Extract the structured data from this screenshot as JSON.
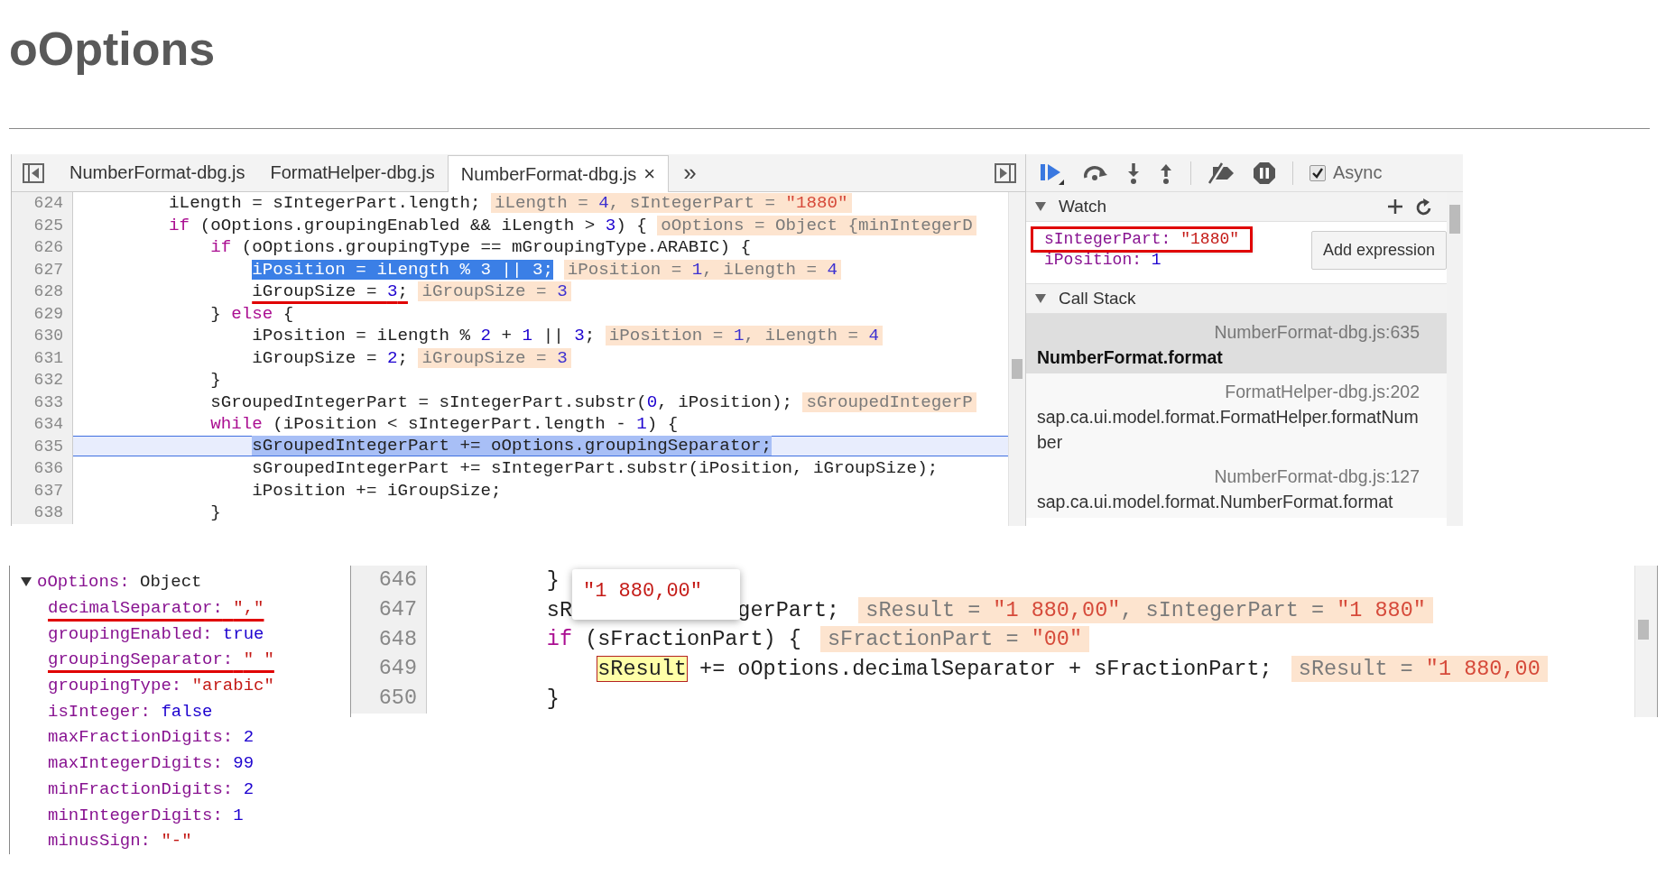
{
  "title": "oOptions",
  "sources": {
    "tabs": [
      {
        "label": "NumberFormat-dbg.js",
        "selected": false
      },
      {
        "label": "FormatHelper-dbg.js",
        "selected": false
      },
      {
        "label": "NumberFormat-dbg.js",
        "selected": true,
        "close": "×"
      }
    ],
    "more": "»",
    "lines": [
      {
        "number": "624",
        "current": false,
        "underlined": false,
        "code": [
          {
            "kind": "plain",
            "text": "iLength = sIntegerPart.length;"
          }
        ],
        "value": [
          {
            "kind": "plain",
            "text": "iLength = "
          },
          {
            "kind": "num",
            "text": "4"
          },
          {
            "kind": "plain",
            "text": ", sIntegerPart = "
          },
          {
            "kind": "str",
            "text": "\"1880\""
          }
        ]
      },
      {
        "number": "625",
        "current": false,
        "underlined": false,
        "code": [
          {
            "kind": "kw",
            "text": "if"
          },
          {
            "kind": "plain",
            "text": " (oOptions.groupingEnabled && iLength > "
          },
          {
            "kind": "num",
            "text": "3"
          },
          {
            "kind": "plain",
            "text": ") {"
          }
        ],
        "value": [
          {
            "kind": "plain",
            "text": "oOptions = Object {minIntegerD"
          }
        ],
        "children": [
          {
            "number": "626",
            "current": false,
            "underlined": false,
            "code": [
              {
                "kind": "kw",
                "text": "if"
              },
              {
                "kind": "plain",
                "text": " (oOptions.groupingType == mGroupingType.ARABIC) {"
              }
            ],
            "children": [
              {
                "number": "627",
                "current": false,
                "underlined": false,
                "code": [
                  {
                    "kind": "sel",
                    "text": "iPosition = iLength % 3 || 3;"
                  }
                ],
                "value": [
                  {
                    "kind": "plain",
                    "text": "iPosition = "
                  },
                  {
                    "kind": "num",
                    "text": "1"
                  },
                  {
                    "kind": "plain",
                    "text": ", iLength = "
                  },
                  {
                    "kind": "num",
                    "text": "4"
                  }
                ]
              },
              {
                "number": "628",
                "current": false,
                "underlined": true,
                "code": [
                  {
                    "kind": "plain",
                    "text": "iGroupSize = "
                  },
                  {
                    "kind": "num",
                    "text": "3"
                  },
                  {
                    "kind": "plain",
                    "text": ";"
                  }
                ],
                "value": [
                  {
                    "kind": "plain",
                    "text": "iGroupSize = "
                  },
                  {
                    "kind": "num",
                    "text": "3"
                  }
                ]
              }
            ]
          },
          {
            "number": "629",
            "current": false,
            "underlined": false,
            "code": [
              {
                "kind": "plain",
                "text": "} "
              },
              {
                "kind": "kw",
                "text": "else"
              },
              {
                "kind": "plain",
                "text": " {"
              }
            ],
            "children": [
              {
                "number": "630",
                "current": false,
                "underlined": false,
                "code": [
                  {
                    "kind": "plain",
                    "text": "iPosition = iLength % "
                  },
                  {
                    "kind": "num",
                    "text": "2"
                  },
                  {
                    "kind": "plain",
                    "text": " + "
                  },
                  {
                    "kind": "num",
                    "text": "1"
                  },
                  {
                    "kind": "plain",
                    "text": " || "
                  },
                  {
                    "kind": "num",
                    "text": "3"
                  },
                  {
                    "kind": "plain",
                    "text": ";"
                  }
                ],
                "value": [
                  {
                    "kind": "plain",
                    "text": "iPosition = "
                  },
                  {
                    "kind": "num",
                    "text": "1"
                  },
                  {
                    "kind": "plain",
                    "text": ", iLength = "
                  },
                  {
                    "kind": "num",
                    "text": "4"
                  }
                ]
              },
              {
                "number": "631",
                "current": false,
                "underlined": false,
                "code": [
                  {
                    "kind": "plain",
                    "text": "iGroupSize = "
                  },
                  {
                    "kind": "num",
                    "text": "2"
                  },
                  {
                    "kind": "plain",
                    "text": ";"
                  }
                ],
                "value": [
                  {
                    "kind": "plain",
                    "text": "iGroupSize = "
                  },
                  {
                    "kind": "num",
                    "text": "3"
                  }
                ]
              }
            ]
          },
          {
            "number": "632",
            "current": false,
            "underlined": false,
            "code": [
              {
                "kind": "plain",
                "text": "}"
              }
            ]
          },
          {
            "number": "633",
            "current": false,
            "underlined": false,
            "code": [
              {
                "kind": "plain",
                "text": "sGroupedIntegerPart = sIntegerPart.substr("
              },
              {
                "kind": "num",
                "text": "0"
              },
              {
                "kind": "plain",
                "text": ", iPosition);"
              }
            ],
            "value": [
              {
                "kind": "plain",
                "text": "sGroupedIntegerP"
              }
            ]
          },
          {
            "number": "634",
            "current": false,
            "underlined": false,
            "code": [
              {
                "kind": "kw",
                "text": "while"
              },
              {
                "kind": "plain",
                "text": " (iPosition < sIntegerPart.length - "
              },
              {
                "kind": "num",
                "text": "1"
              },
              {
                "kind": "plain",
                "text": ") {"
              }
            ],
            "children": [
              {
                "number": "635",
                "current": true,
                "underlined": false,
                "code": [
                  {
                    "kind": "exec",
                    "text": "sGroupedIntegerPart += oOptions.groupingSeparator;"
                  }
                ]
              },
              {
                "number": "636",
                "current": false,
                "underlined": false,
                "code": [
                  {
                    "kind": "plain",
                    "text": "sGroupedIntegerPart += sIntegerPart.substr(iPosition, iGroupSize);"
                  }
                ]
              },
              {
                "number": "637",
                "current": false,
                "underlined": false,
                "code": [
                  {
                    "kind": "plain",
                    "text": "iPosition += iGroupSize;"
                  }
                ]
              }
            ]
          },
          {
            "number": "638",
            "current": false,
            "underlined": false,
            "code": [
              {
                "kind": "plain",
                "text": "}"
              }
            ]
          }
        ]
      }
    ]
  },
  "debugger": {
    "async": {
      "label": "Async",
      "checked": true
    },
    "watch": {
      "title": "Watch",
      "expanded": true,
      "add_button": "Add expression",
      "entries": [
        {
          "name": "sIntegerPart:",
          "value": "\"1880\"",
          "kind": "str",
          "boxed": true
        },
        {
          "name": "iPosition:",
          "value": "1",
          "kind": "num",
          "boxed": false
        }
      ]
    },
    "call_stack": {
      "title": "Call Stack",
      "expanded": true,
      "frames": [
        {
          "location": "NumberFormat-dbg.js:635",
          "function": "NumberFormat.format",
          "selected": true
        },
        {
          "location": "FormatHelper-dbg.js:202",
          "function": "sap.ca.ui.model.format.FormatHelper.formatNumber",
          "selected": false
        },
        {
          "location": "NumberFormat-dbg.js:127",
          "function": "sap.ca.ui.model.format.NumberFormat.format",
          "selected": false
        }
      ]
    }
  },
  "object_tree": {
    "name": "oOptions:",
    "type": "Object",
    "expanded": true,
    "properties": [
      {
        "name": "decimalSeparator:",
        "value": "\",\"",
        "kind": "str",
        "underlined": true
      },
      {
        "name": "groupingEnabled:",
        "value": "true",
        "kind": "num",
        "underlined": false
      },
      {
        "name": "groupingSeparator:",
        "value": "\" \"",
        "kind": "str",
        "underlined": true
      },
      {
        "name": "groupingType:",
        "value": "\"arabic\"",
        "kind": "str",
        "underlined": false
      },
      {
        "name": "isInteger:",
        "value": "false",
        "kind": "num",
        "underlined": false
      },
      {
        "name": "maxFractionDigits:",
        "value": "2",
        "kind": "num",
        "underlined": false
      },
      {
        "name": "maxIntegerDigits:",
        "value": "99",
        "kind": "num",
        "underlined": false
      },
      {
        "name": "minFractionDigits:",
        "value": "2",
        "kind": "num",
        "underlined": false
      },
      {
        "name": "minIntegerDigits:",
        "value": "1",
        "kind": "num",
        "underlined": false
      },
      {
        "name": "minusSign:",
        "value": "\"-\"",
        "kind": "str",
        "underlined": false
      }
    ]
  },
  "snippet": {
    "tooltip": "\"1 880,00\"",
    "lines": [
      {
        "number": "646",
        "code": [
          {
            "kind": "plain",
            "text": "}"
          }
        ]
      },
      {
        "number": "647",
        "code": [
          {
            "kind": "plain",
            "text": "sR"
          },
          {
            "kind": "after-tooltip",
            "text": "gerPart;"
          }
        ],
        "value": [
          {
            "kind": "plain",
            "text": "sResult = "
          },
          {
            "kind": "str",
            "text": "\"1 880,00\""
          },
          {
            "kind": "plain",
            "text": ", sIntegerPart = "
          },
          {
            "kind": "str",
            "text": "\"1 880\""
          }
        ]
      },
      {
        "number": "648",
        "code": [
          {
            "kind": "kw",
            "text": "if"
          },
          {
            "kind": "plain",
            "text": " (sFractionPart) {"
          }
        ],
        "value": [
          {
            "kind": "plain",
            "text": "sFractionPart = "
          },
          {
            "kind": "str",
            "text": "\"00\""
          }
        ],
        "children": [
          {
            "number": "649",
            "code": [
              {
                "kind": "hover",
                "text": "sResult"
              },
              {
                "kind": "plain",
                "text": " += oOptions.decimalSeparator + sFractionPart;"
              }
            ],
            "value": [
              {
                "kind": "plain",
                "text": "sResult = "
              },
              {
                "kind": "str",
                "text": "\"1 880,00"
              }
            ]
          }
        ]
      },
      {
        "number": "650",
        "code": [
          {
            "kind": "plain",
            "text": "}"
          }
        ]
      }
    ]
  }
}
